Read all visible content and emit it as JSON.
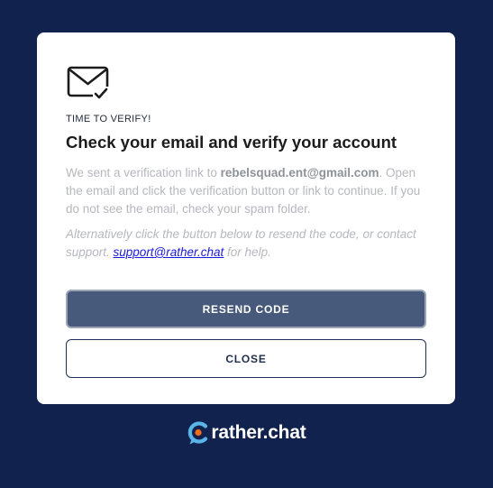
{
  "dialog": {
    "icon": "mail-check-icon",
    "eyebrow": "TIME TO VERIFY!",
    "title": "Check your email and verify your account",
    "message": {
      "prefix": "We sent a verification link to ",
      "email": "rebelsquad.ent@gmail.com",
      "suffix": ". Open the email and click the verification button or link to continue. If you do not see the email, check your spam folder."
    },
    "alternative": {
      "prefix": "Alternatively click the button below to resend the code, or contact support. ",
      "link": "support@rather.chat",
      "suffix": " for help."
    },
    "resend_label": "RESEND CODE",
    "close_label": "CLOSE"
  },
  "brand": {
    "logo_icon": "rather-chat-logo-icon",
    "name": "rather.chat"
  },
  "colors": {
    "background": "#10224d",
    "primary_button": "#475a7b",
    "link": "#1a1adb",
    "logo_blue": "#5ab4e8",
    "logo_orange": "#f26b1d"
  }
}
